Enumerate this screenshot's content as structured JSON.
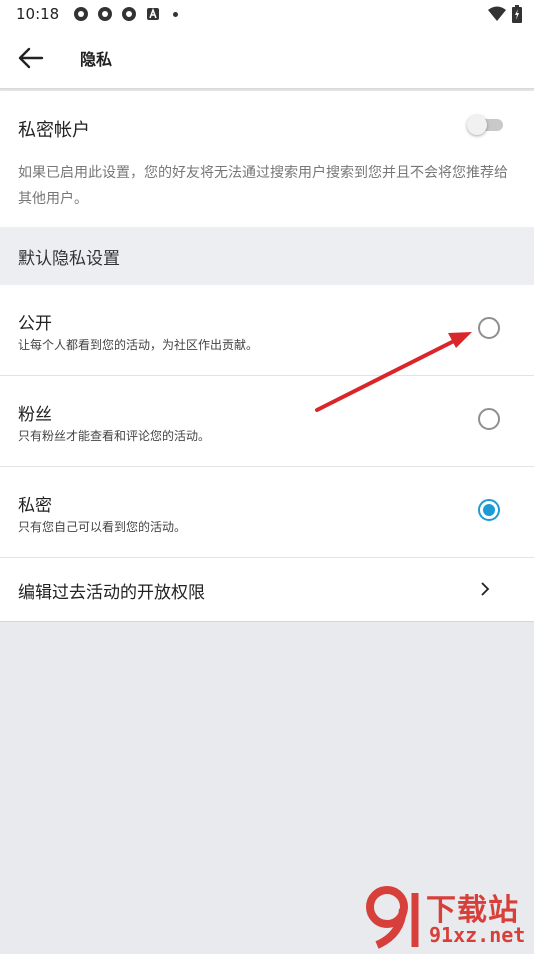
{
  "status_bar": {
    "time": "10:18"
  },
  "appbar": {
    "title": "隐私"
  },
  "private_account": {
    "label": "私密帐户",
    "enabled": false,
    "description": "如果已启用此设置，您的好友将无法通过搜索用户搜索到您并且不会将您推荐给其他用户。"
  },
  "default_privacy": {
    "header": "默认隐私设置",
    "options": [
      {
        "title": "公开",
        "description": "让每个人都看到您的活动，为社区作出贡献。",
        "selected": false
      },
      {
        "title": "粉丝",
        "description": "只有粉丝才能查看和评论您的活动。",
        "selected": false
      },
      {
        "title": "私密",
        "description": "只有您自己可以看到您的活动。",
        "selected": true
      }
    ]
  },
  "edit_past": {
    "label": "编辑过去活动的开放权限"
  },
  "colors": {
    "accent": "#1e9bd7",
    "annotation_arrow": "#d8262a"
  },
  "watermark": {
    "top_text": "下载站",
    "bottom_text": "91xz.net"
  }
}
